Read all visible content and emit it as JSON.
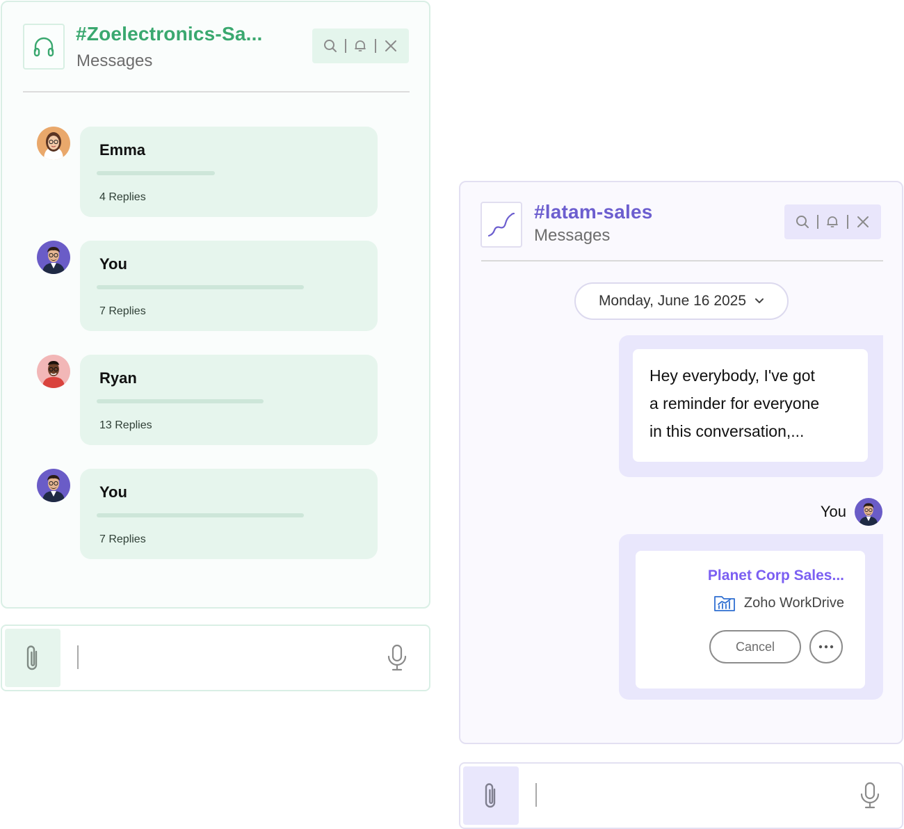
{
  "left_channel": {
    "title": "#Zoelectronics-Sa...",
    "subtitle": "Messages",
    "icon": "headphones-icon",
    "accent_color": "#3aa86f",
    "threads": [
      {
        "name": "Emma",
        "replies": "4 Replies",
        "avatar": "avatar-emma"
      },
      {
        "name": "You",
        "replies": "7 Replies",
        "avatar": "avatar-you"
      },
      {
        "name": "Ryan",
        "replies": "13 Replies",
        "avatar": "avatar-ryan"
      },
      {
        "name": "You",
        "replies": "7 Replies",
        "avatar": "avatar-you"
      }
    ]
  },
  "left_input": {
    "placeholder": ""
  },
  "right_channel": {
    "title": "#latam-sales",
    "subtitle": "Messages",
    "icon": "trend-line-icon",
    "accent_color": "#6c5ecf",
    "date_filter": "Monday, June 16 2025",
    "message_lines": [
      "Hey everybody, I've got",
      "a reminder for everyone",
      "in this conversation,..."
    ],
    "sender": "You",
    "file": {
      "title": "Planet Corp Sales...",
      "source": "Zoho WorkDrive",
      "cancel_label": "Cancel"
    }
  },
  "right_input": {
    "placeholder": ""
  }
}
